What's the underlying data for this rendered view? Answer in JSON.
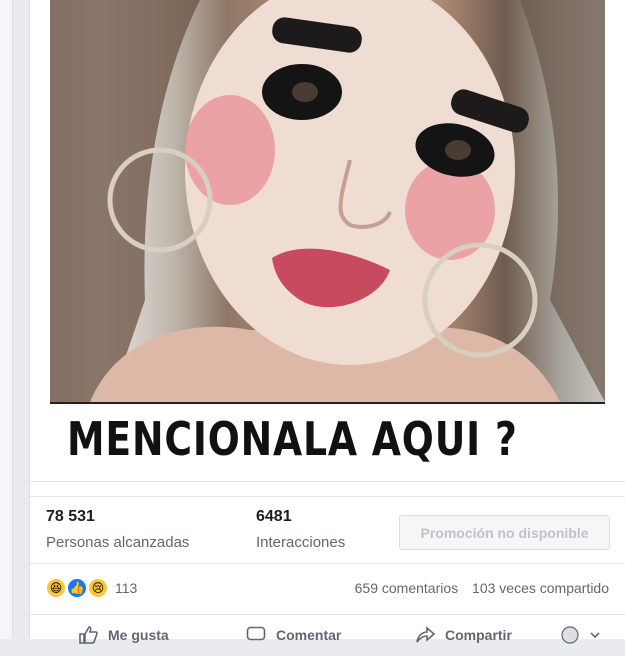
{
  "post": {
    "caption": "MENCIONALA AQUI ?"
  },
  "insights": {
    "reach_value": "78 531",
    "reach_label": "Personas alcanzadas",
    "engagement_value": "6481",
    "engagement_label": "Interacciones",
    "promo_button": "Promoción no disponible"
  },
  "reactions": {
    "icons": [
      "haha-icon",
      "like-icon",
      "sad-icon"
    ],
    "count": "113",
    "comments": "659 comentarios",
    "shares": "103 veces compartido"
  },
  "actions": {
    "like": "Me gusta",
    "comment": "Comentar",
    "share": "Compartir"
  },
  "colors": {
    "like_blue": "#1877f2",
    "text_muted": "#606770",
    "text_dark": "#1c1e21"
  }
}
